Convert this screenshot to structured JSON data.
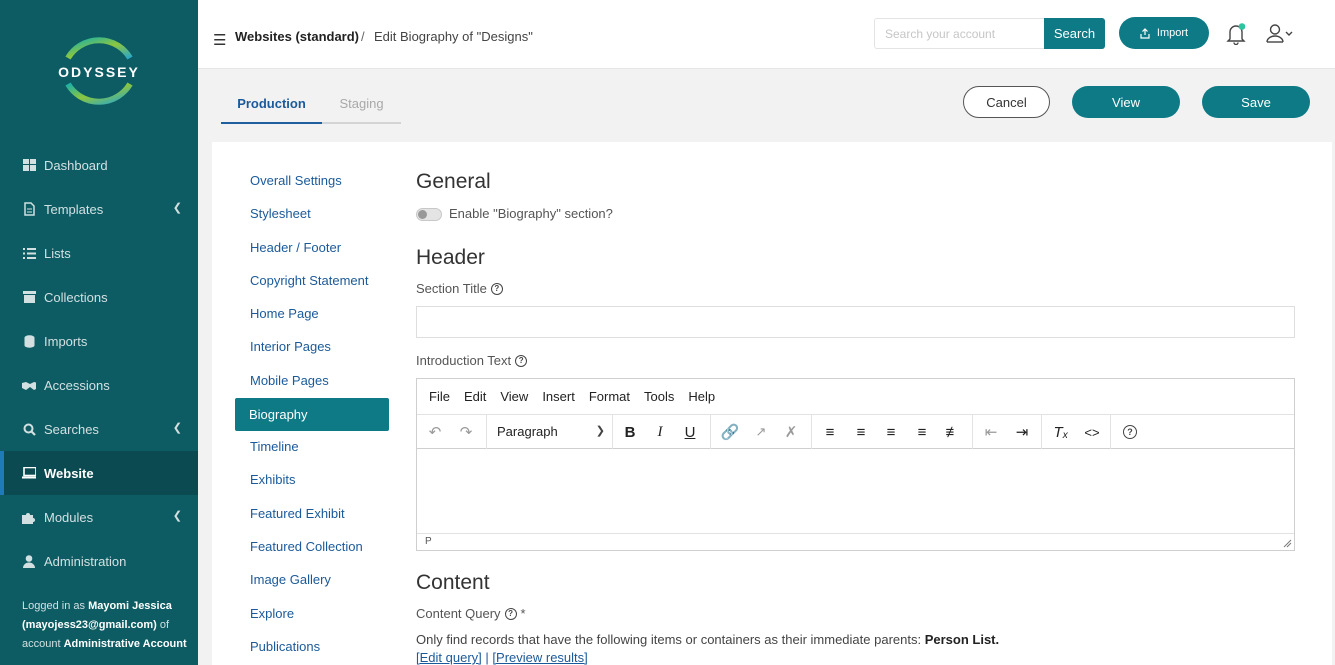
{
  "brand": {
    "logo_text": "ODYSSEY",
    "accent": "#0d7a86",
    "sidebar_bg": "#0d5c63"
  },
  "sidebar": {
    "items": [
      {
        "label": "Dashboard",
        "icon": "dashboard-icon",
        "chevron": false
      },
      {
        "label": "Templates",
        "icon": "file-icon",
        "chevron": true
      },
      {
        "label": "Lists",
        "icon": "list-icon",
        "chevron": false
      },
      {
        "label": "Collections",
        "icon": "archive-icon",
        "chevron": false
      },
      {
        "label": "Imports",
        "icon": "database-icon",
        "chevron": false
      },
      {
        "label": "Accessions",
        "icon": "handshake-icon",
        "chevron": false
      },
      {
        "label": "Searches",
        "icon": "search-icon",
        "chevron": true
      },
      {
        "label": "Website",
        "icon": "laptop-icon",
        "chevron": false,
        "active": true
      },
      {
        "label": "Modules",
        "icon": "puzzle-icon",
        "chevron": true
      },
      {
        "label": "Administration",
        "icon": "user-icon",
        "chevron": false
      }
    ],
    "logged_prefix": "Logged in as",
    "logged_user": "Mayomi Jessica (mayojess23@gmail.com)",
    "logged_of": "of account",
    "logged_account": "Administrative Account"
  },
  "topbar": {
    "crumb_root": "Websites (standard)",
    "crumb_sep": "/",
    "crumb_current": "Edit Biography of \"Designs\"",
    "search_placeholder": "Search your account",
    "search_label": "Search",
    "import_label": "Import"
  },
  "tabs": [
    {
      "label": "Production",
      "active": true
    },
    {
      "label": "Staging",
      "active": false
    }
  ],
  "actions": {
    "cancel": "Cancel",
    "view": "View",
    "save": "Save"
  },
  "settings_nav": [
    "Overall Settings",
    "Stylesheet",
    "Header / Footer",
    "Copyright Statement",
    "Home Page",
    "Interior Pages",
    "Mobile Pages",
    "Biography",
    "Timeline",
    "Exhibits",
    "Featured Exhibit",
    "Featured Collection",
    "Image Gallery",
    "Explore",
    "Publications"
  ],
  "form": {
    "general_heading": "General",
    "enable_label": "Enable \"Biography\" section?",
    "header_heading": "Header",
    "section_title_label": "Section Title",
    "section_title_value": "",
    "intro_label": "Introduction Text",
    "editor": {
      "menus": [
        "File",
        "Edit",
        "View",
        "Insert",
        "Format",
        "Tools",
        "Help"
      ],
      "block_format": "Paragraph",
      "status_path": "P"
    },
    "content_heading": "Content",
    "content_query_label": "Content Query",
    "required_mark": "*",
    "query_desc": "Only find records that have the following items or containers as their immediate parents:",
    "query_target": "Person List.",
    "edit_query": "[Edit query]",
    "link_sep": "|",
    "preview_results": "[Preview results]"
  }
}
